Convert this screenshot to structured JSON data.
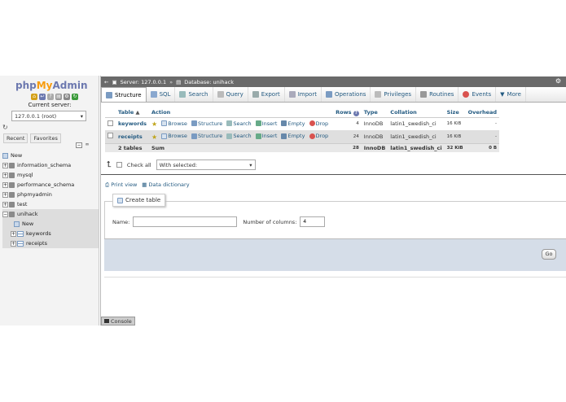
{
  "logo": {
    "php": "php",
    "my": "My",
    "admin": "Admin"
  },
  "sidebar": {
    "current_server_label": "Current server:",
    "server_value": "127.0.0.1 (root)",
    "tabs": [
      "Recent",
      "Favorites"
    ],
    "tree": [
      {
        "label": "New",
        "type": "new",
        "indent": 0
      },
      {
        "label": "information_schema",
        "type": "db",
        "indent": 0
      },
      {
        "label": "mysql",
        "type": "db",
        "indent": 0
      },
      {
        "label": "performance_schema",
        "type": "db",
        "indent": 0
      },
      {
        "label": "phpmyadmin",
        "type": "db",
        "indent": 0
      },
      {
        "label": "test",
        "type": "db",
        "indent": 0
      },
      {
        "label": "unihack",
        "type": "db",
        "indent": 0,
        "selected": true
      },
      {
        "label": "New",
        "type": "new",
        "indent": 1
      },
      {
        "label": "keywords",
        "type": "table",
        "indent": 1
      },
      {
        "label": "receipts",
        "type": "table",
        "indent": 1
      }
    ]
  },
  "breadcrumb": {
    "server": "Server: 127.0.0.1",
    "database": "Database: unihack"
  },
  "menu": [
    "Structure",
    "SQL",
    "Search",
    "Query",
    "Export",
    "Import",
    "Operations",
    "Privileges",
    "Routines",
    "Events",
    "More"
  ],
  "table": {
    "headers": {
      "table": "Table",
      "action": "Action",
      "rows": "Rows",
      "type": "Type",
      "collation": "Collation",
      "size": "Size",
      "overhead": "Overhead"
    },
    "actions": [
      "Browse",
      "Structure",
      "Search",
      "Insert",
      "Empty",
      "Drop"
    ],
    "rows": [
      {
        "name": "keywords",
        "rows": "4",
        "type": "InnoDB",
        "collation": "latin1_swedish_ci",
        "size": "16 KiB",
        "overhead": "-"
      },
      {
        "name": "receipts",
        "rows": "24",
        "type": "InnoDB",
        "collation": "latin1_swedish_ci",
        "size": "16 KiB",
        "overhead": "-"
      }
    ],
    "sum": {
      "name": "2 tables",
      "label": "Sum",
      "rows": "28",
      "type": "InnoDB",
      "collation": "latin1_swedish_ci",
      "size": "32 KiB",
      "overhead": "0 B"
    }
  },
  "bulk": {
    "check_all": "Check all",
    "with_selected": "With selected:"
  },
  "links": {
    "print_view": "Print view",
    "data_dictionary": "Data dictionary"
  },
  "create": {
    "legend": "Create table",
    "name_label": "Name:",
    "name_value": "",
    "columns_label": "Number of columns:",
    "columns_value": "4",
    "go": "Go"
  },
  "console": "Console"
}
